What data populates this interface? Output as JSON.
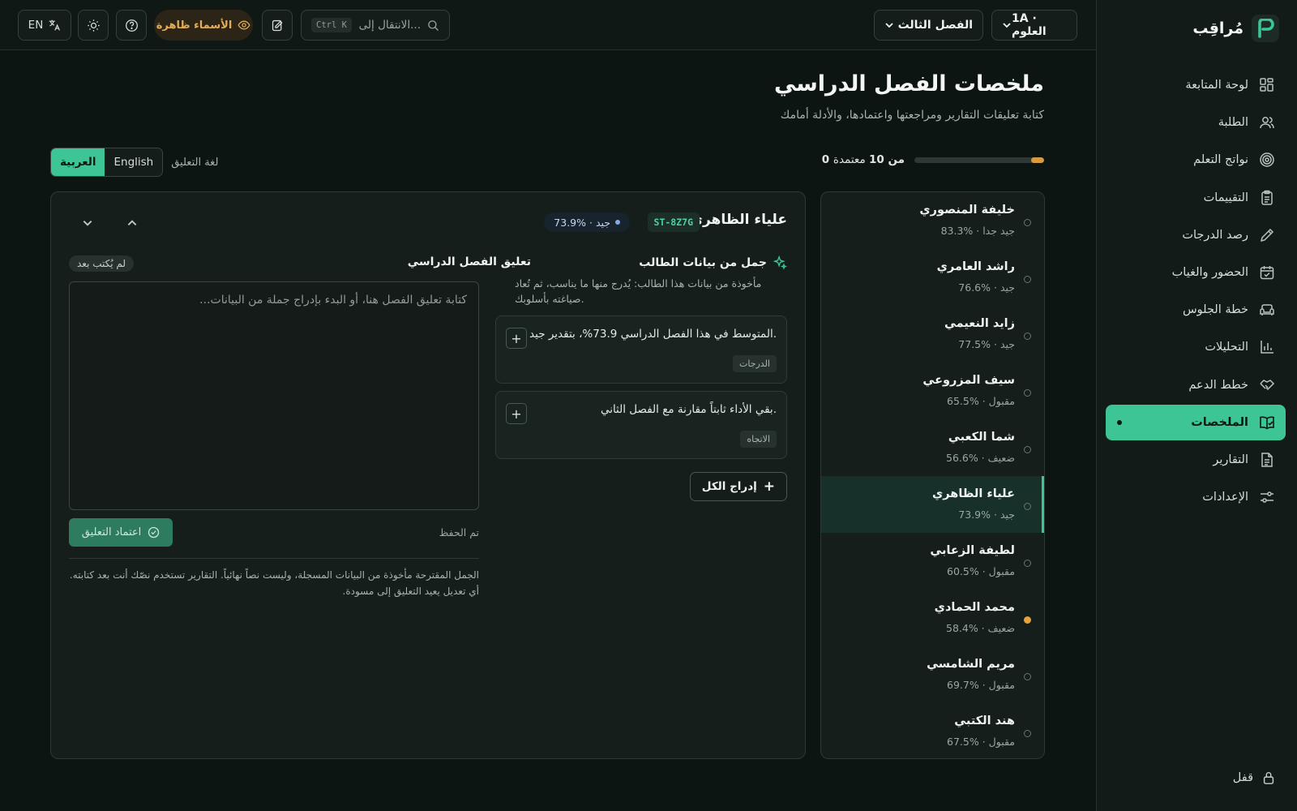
{
  "app": {
    "name": "مُراقِب"
  },
  "sidebar": {
    "items": [
      {
        "label": "لوحة المتابعة",
        "icon": "dashboard-icon"
      },
      {
        "label": "الطلبة",
        "icon": "users-icon"
      },
      {
        "label": "نواتج التعلم",
        "icon": "target-icon"
      },
      {
        "label": "التقييمات",
        "icon": "clipboard-icon"
      },
      {
        "label": "رصد الدرجات",
        "icon": "pencil-icon"
      },
      {
        "label": "الحضور والغياب",
        "icon": "calendar-check-icon"
      },
      {
        "label": "خطة الجلوس",
        "icon": "sofa-icon"
      },
      {
        "label": "التحليلات",
        "icon": "bar-chart-icon"
      },
      {
        "label": "خطط الدعم",
        "icon": "handshake-icon"
      },
      {
        "label": "الملخصات",
        "icon": "book-check-icon",
        "active": true
      },
      {
        "label": "التقارير",
        "icon": "file-text-icon"
      },
      {
        "label": "الإعدادات",
        "icon": "sliders-icon"
      }
    ],
    "lock_label": "قفل"
  },
  "topbar": {
    "class_select": "1A · العلوم",
    "term_select": "الفصل الثالث",
    "search_placeholder": "الانتقال إلى...",
    "search_shortcut": "Ctrl K",
    "names_toggle": "الأسماء ظاهرة",
    "lang_button": "EN"
  },
  "header": {
    "title": "ملخصات الفصل الدراسي",
    "subtitle": "كتابة تعليقات التقارير ومراجعتها واعتمادها، والأدلة أمامك",
    "progress_text_bold": "0 من 10",
    "progress_text_rest": "معتمدة",
    "progress_fraction": 0.1,
    "lang_label": "لغة التعليق",
    "lang_options": [
      "English",
      "العربية"
    ],
    "lang_selected": "العربية"
  },
  "students": [
    {
      "name": "خليفة المنصوري",
      "grade": "83.3% · جيد جدا",
      "status": "none"
    },
    {
      "name": "راشد العامري",
      "grade": "76.6% · جيد",
      "status": "none"
    },
    {
      "name": "زايد النعيمي",
      "grade": "77.5% · جيد",
      "status": "none"
    },
    {
      "name": "سيف المزروعي",
      "grade": "65.5% · مقبول",
      "status": "none"
    },
    {
      "name": "شما الكعبي",
      "grade": "56.6% · ضعيف",
      "status": "none"
    },
    {
      "name": "علياء الظاهري",
      "grade": "73.9% · جيد",
      "status": "none",
      "active": true
    },
    {
      "name": "لطيفة الزعابي",
      "grade": "60.5% · مقبول",
      "status": "none"
    },
    {
      "name": "محمد الحمادي",
      "grade": "58.4% · ضعيف",
      "status": "warning"
    },
    {
      "name": "مريم الشامسي",
      "grade": "69.7% · مقبول",
      "status": "none"
    },
    {
      "name": "هند الكتبي",
      "grade": "67.5% · مقبول",
      "status": "none"
    }
  ],
  "detail": {
    "name": "علياء الظاهري",
    "id": "ST-8Z7G",
    "grade_badge": "73.9% · جيد",
    "suggestions_title": "جمل من بيانات الطالب",
    "suggestions_desc": "مأخوذة من بيانات هذا الطالب: يُدرج منها ما يناسب، ثم تُعاد صياغته بأسلوبك.",
    "suggestions": [
      {
        "text": "المتوسط في هذا الفصل الدراسي 73.9%، بتقدير جيد.",
        "tag": "الدرجات"
      },
      {
        "text": "بقي الأداء ثابتاً مقارنة مع الفصل الثاني.",
        "tag": "الاتجاه"
      }
    ],
    "insert_all": "إدراج الكل",
    "comment_title": "تعليق الفصل الدراسي",
    "comment_status": "لم يُكتب بعد",
    "comment_placeholder": "كتابة تعليق الفصل هنا، أو البدء بإدراج جملة من البيانات...",
    "comment_value": "",
    "approve_label": "اعتماد التعليق",
    "saved_label": "تم الحفظ",
    "footer_note": "الجمل المقترحة مأخوذة من البيانات المسجلة، وليست نصاً نهائياً. التقارير تستخدم نصّك أنت بعد كتابته. أي تعديل يعيد التعليق إلى مسودة."
  },
  "colors": {
    "accent": "#3ec596",
    "warning": "#e6a23c",
    "progress": "#d89a3f"
  }
}
